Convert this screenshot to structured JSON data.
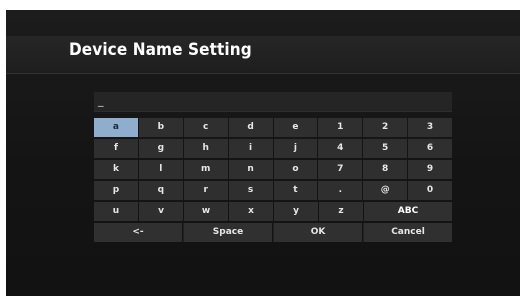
{
  "header": {
    "title": "Device Name Setting"
  },
  "input": {
    "value": "_"
  },
  "keyboard": {
    "rows": [
      [
        "a",
        "b",
        "c",
        "d",
        "e",
        "1",
        "2",
        "3"
      ],
      [
        "f",
        "g",
        "h",
        "i",
        "j",
        "4",
        "5",
        "6"
      ],
      [
        "k",
        "l",
        "m",
        "n",
        "o",
        "7",
        "8",
        "9"
      ],
      [
        "p",
        "q",
        "r",
        "s",
        "t",
        ".",
        "@",
        "0"
      ],
      [
        "u",
        "v",
        "w",
        "x",
        "y",
        "z",
        "ABC"
      ]
    ],
    "selected_key": "a",
    "actions": {
      "backspace": "<-",
      "space": "Space",
      "ok": "OK",
      "cancel": "Cancel"
    }
  },
  "colors": {
    "background": "#141414",
    "key": "#2f2f2f",
    "selected": "#8faecd",
    "abc": "#cfcfcf"
  }
}
